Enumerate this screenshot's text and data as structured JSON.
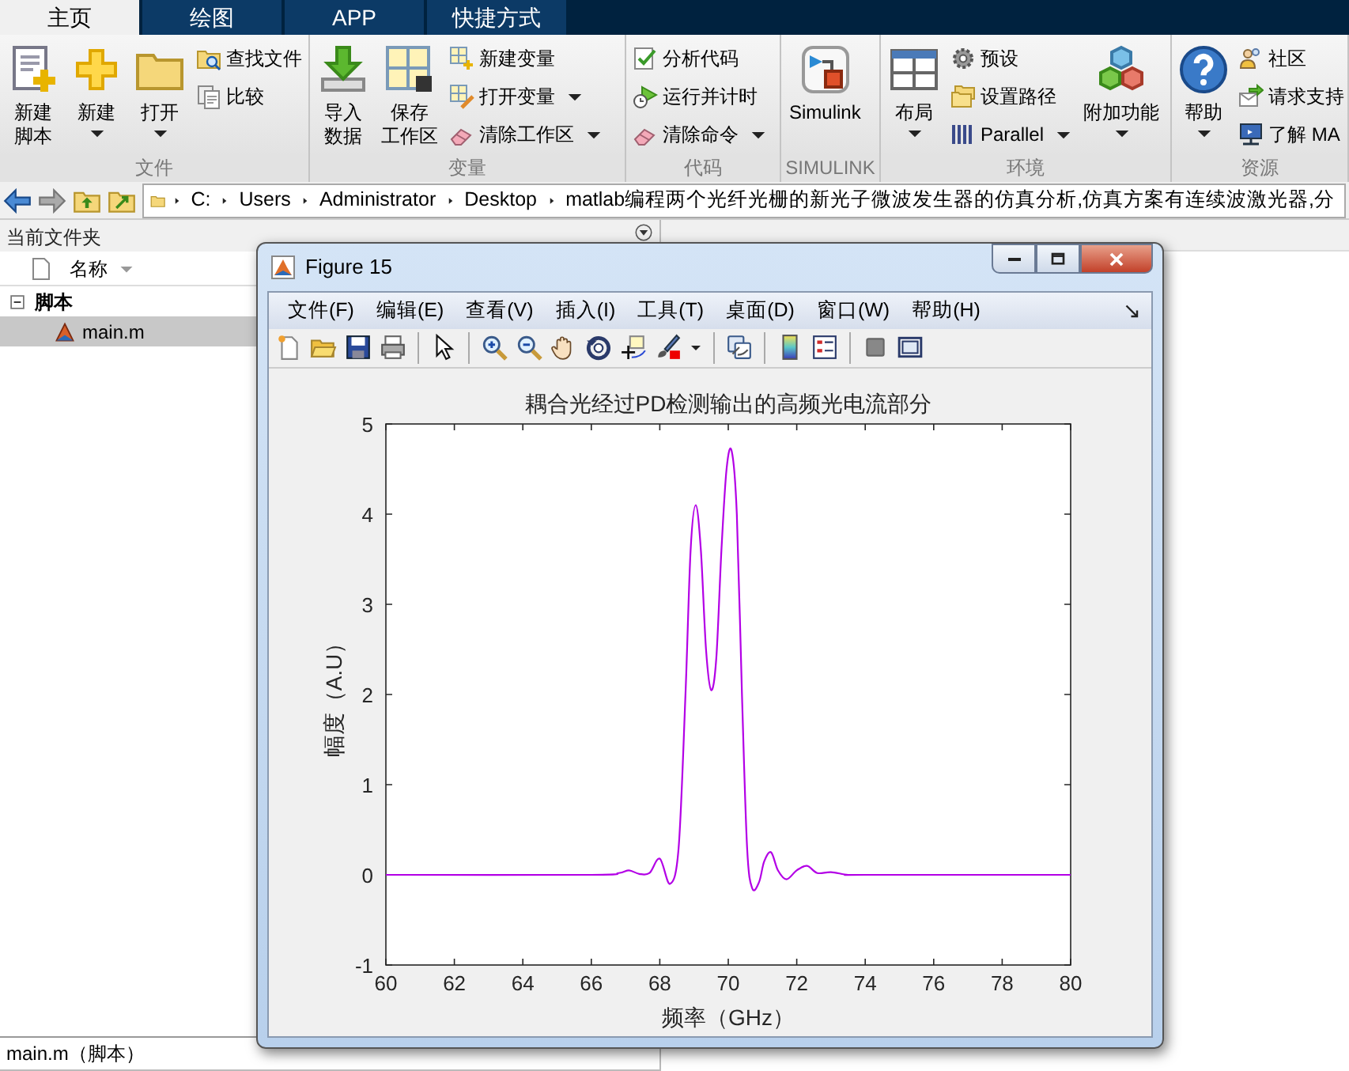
{
  "ribbon": {
    "tabs": [
      {
        "label": "主页",
        "selected": true
      },
      {
        "label": "绘图",
        "selected": false
      },
      {
        "label": "APP",
        "selected": false
      },
      {
        "label": "快捷方式",
        "selected": false
      }
    ],
    "groups": [
      {
        "label": "文件",
        "items": [
          {
            "kind": "large",
            "lines": [
              "新建",
              "脚本"
            ],
            "dropdown": false
          },
          {
            "kind": "large",
            "lines": [
              "新建"
            ],
            "dropdown": true
          },
          {
            "kind": "large",
            "lines": [
              "打开"
            ],
            "dropdown": true
          },
          {
            "kind": "stack",
            "items": [
              {
                "label": "查找文件",
                "dropdown": false
              },
              {
                "label": "比较",
                "dropdown": false
              }
            ]
          }
        ]
      },
      {
        "label": "变量",
        "items": [
          {
            "kind": "large",
            "lines": [
              "导入",
              "数据"
            ],
            "dropdown": false
          },
          {
            "kind": "large",
            "lines": [
              "保存",
              "工作区"
            ],
            "dropdown": false
          },
          {
            "kind": "stack",
            "items": [
              {
                "label": "新建变量",
                "dropdown": false
              },
              {
                "label": "打开变量",
                "dropdown": true
              },
              {
                "label": "清除工作区",
                "dropdown": true
              }
            ]
          }
        ]
      },
      {
        "label": "代码",
        "items": [
          {
            "kind": "stack",
            "items": [
              {
                "label": "分析代码",
                "dropdown": false
              },
              {
                "label": "运行并计时",
                "dropdown": false
              },
              {
                "label": "清除命令",
                "dropdown": true
              }
            ]
          }
        ]
      },
      {
        "label": "SIMULINK",
        "items": [
          {
            "kind": "large",
            "lines": [
              "Simulink"
            ],
            "dropdown": false
          }
        ]
      },
      {
        "label": "环境",
        "items": [
          {
            "kind": "large",
            "lines": [
              "布局"
            ],
            "dropdown": true
          },
          {
            "kind": "stack",
            "items": [
              {
                "label": "预设",
                "dropdown": false
              },
              {
                "label": "设置路径",
                "dropdown": false
              },
              {
                "label": "Parallel",
                "dropdown": true
              }
            ]
          },
          {
            "kind": "large",
            "lines": [
              "附加功能"
            ],
            "dropdown": true
          }
        ]
      },
      {
        "label": "资源",
        "items": [
          {
            "kind": "large",
            "lines": [
              "帮助"
            ],
            "dropdown": true
          },
          {
            "kind": "stack",
            "items": [
              {
                "label": "社区",
                "dropdown": false
              },
              {
                "label": "请求支持",
                "dropdown": false
              },
              {
                "label": "了解 MA",
                "dropdown": false
              }
            ]
          }
        ]
      }
    ]
  },
  "address": {
    "path": [
      "C:",
      "Users",
      "Administrator",
      "Desktop",
      "matlab编程两个光纤光栅的新光子微波发生器的仿真分析,仿真方案有连续波激光器,分"
    ]
  },
  "current_folder": {
    "title": "当前文件夹",
    "column": "名称",
    "tree": [
      {
        "label": "脚本",
        "expanded": true,
        "children": [
          {
            "label": "main.m",
            "selected": true
          }
        ]
      }
    ],
    "details": "main.m（脚本）"
  },
  "figure": {
    "title": "Figure 15",
    "menus": [
      "文件(F)",
      "编辑(E)",
      "查看(V)",
      "插入(I)",
      "工具(T)",
      "桌面(D)",
      "窗口(W)",
      "帮助(H)"
    ],
    "chart_data": {
      "type": "line",
      "title": "耦合光经过PD检测输出的高频光电流部分",
      "xlabel": "频率（GHz）",
      "ylabel": "幅度（A.U）",
      "x": [
        60,
        66,
        66.8,
        67.1,
        67.4,
        67.7,
        68,
        68.3,
        68.55,
        68.75,
        68.9,
        69.05,
        69.2,
        69.35,
        69.5,
        69.65,
        69.8,
        69.95,
        70.1,
        70.25,
        70.4,
        70.55,
        70.7,
        70.9,
        71.05,
        71.25,
        71.45,
        71.7,
        72,
        72.3,
        72.6,
        73,
        73.5,
        74,
        80
      ],
      "series": [
        {
          "color": "#b300e6",
          "values": [
            0,
            0,
            0.02,
            0.05,
            0.01,
            0.02,
            0.18,
            -0.1,
            0.3,
            2.0,
            3.6,
            4.1,
            3.6,
            2.5,
            2.05,
            2.4,
            3.6,
            4.5,
            4.7,
            4.0,
            2.0,
            0.3,
            -0.15,
            -0.08,
            0.15,
            0.25,
            0.05,
            -0.05,
            0.05,
            0.1,
            0.02,
            0.03,
            0,
            0,
            0
          ]
        }
      ],
      "xlim": [
        60,
        80
      ],
      "ylim": [
        -1,
        5
      ],
      "xticks": [
        60,
        62,
        64,
        66,
        68,
        70,
        72,
        74,
        76,
        78,
        80
      ],
      "yticks": [
        -1,
        0,
        1,
        2,
        3,
        4,
        5
      ]
    }
  }
}
